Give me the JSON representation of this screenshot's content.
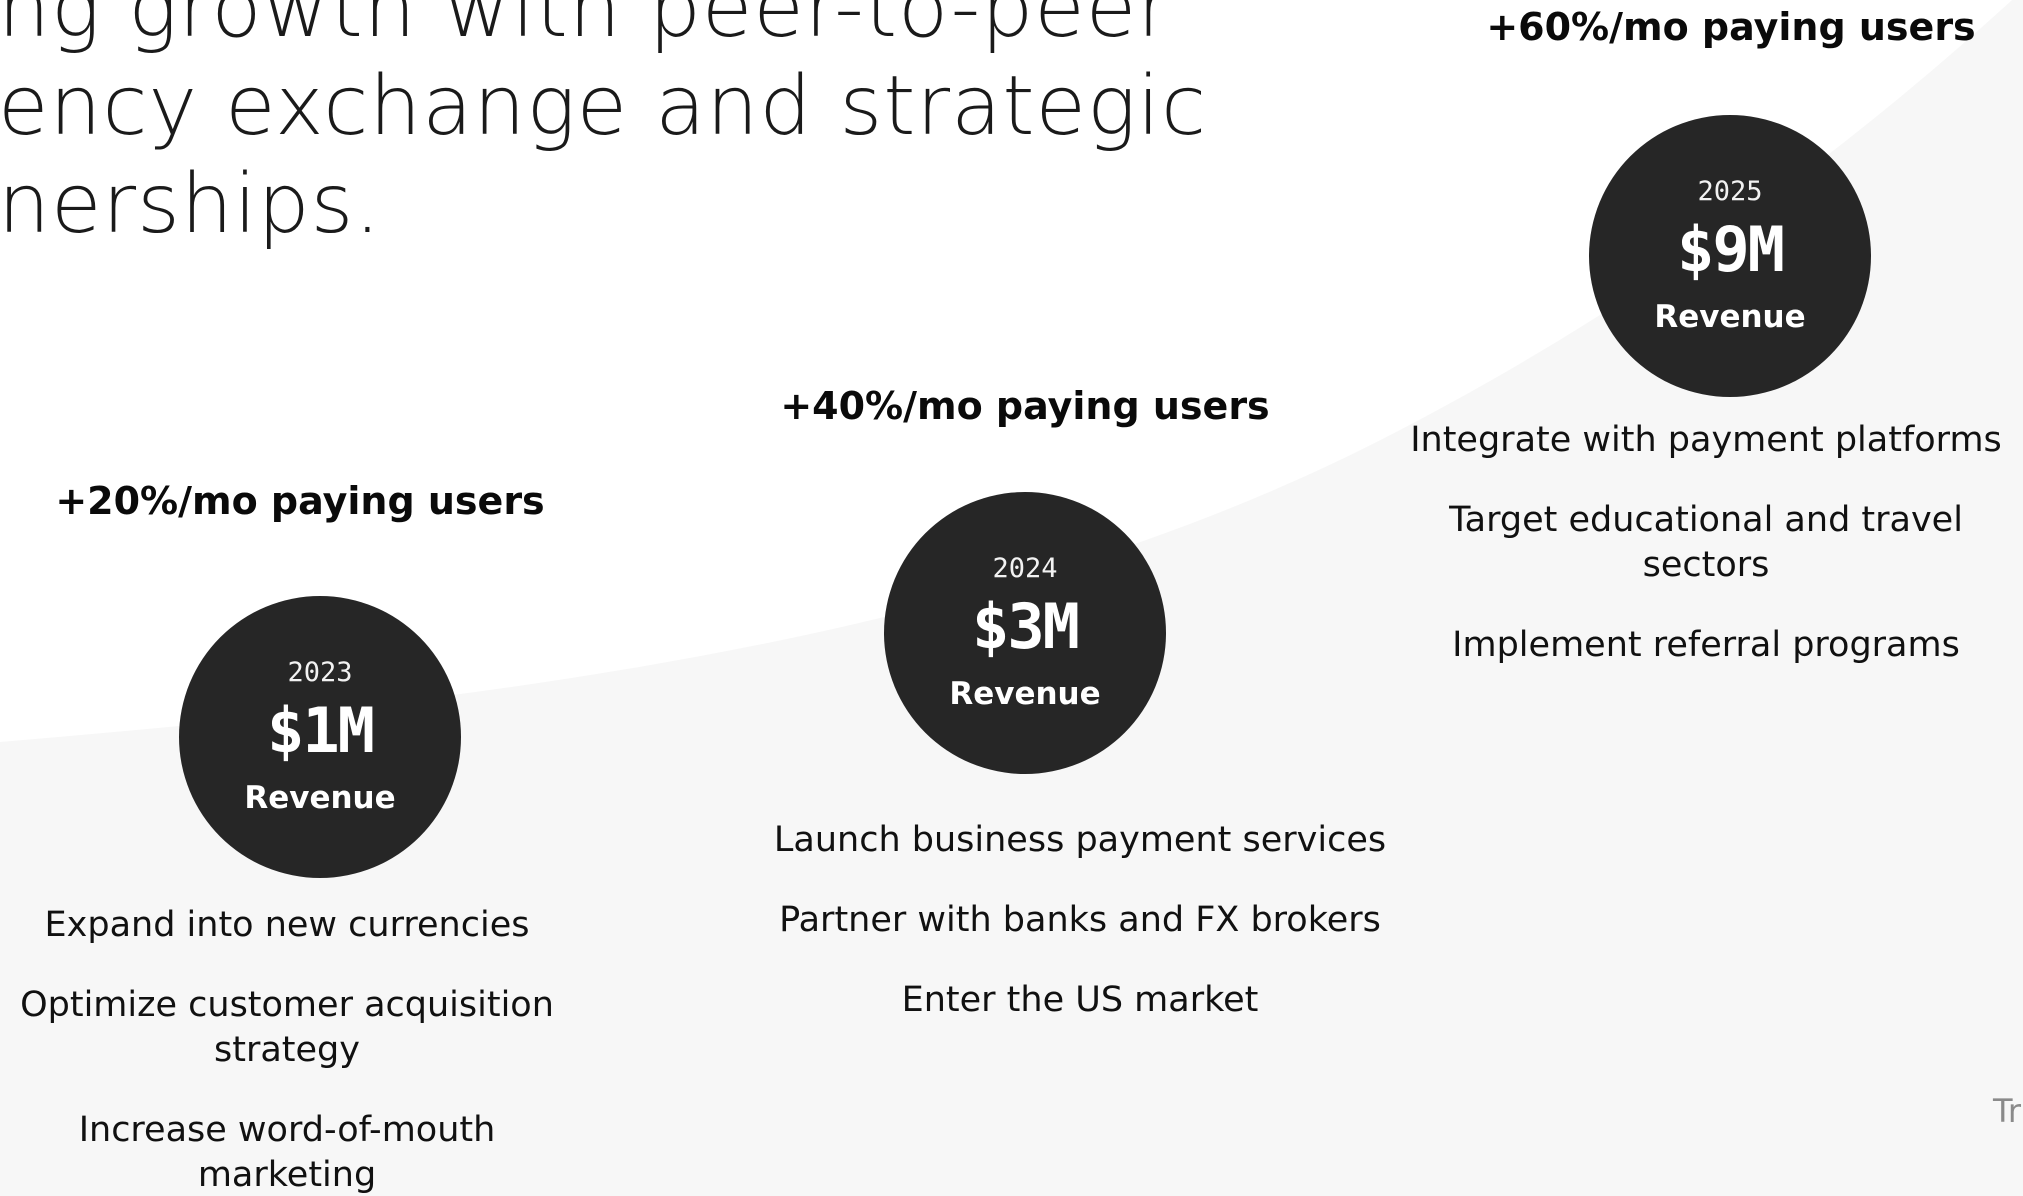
{
  "headline": {
    "lines": [
      "ng growth with peer-to-peer",
      "ency exchange and strategic",
      "nerships."
    ]
  },
  "milestones": [
    {
      "growth": "+20%/mo paying users",
      "year": "2023",
      "amount": "$1M",
      "label": "Revenue",
      "actions": [
        "Expand into new currencies",
        "Optimize customer acquisition strategy",
        "Increase word-of-mouth marketing"
      ]
    },
    {
      "growth": "+40%/mo paying users",
      "year": "2024",
      "amount": "$3M",
      "label": "Revenue",
      "actions": [
        "Launch business payment services",
        "Partner with banks and FX brokers",
        "Enter the US market"
      ]
    },
    {
      "growth": "+60%/mo paying users",
      "year": "2025",
      "amount": "$9M",
      "label": "Revenue",
      "actions": [
        "Integrate with payment platforms",
        "Target educational and travel sectors",
        "Implement referral programs"
      ]
    }
  ],
  "corner_text": "Tr",
  "colors": {
    "circle": "#262626",
    "curve_fill": "#f7f7f7",
    "text": "#111111",
    "muted_text": "#8a8a8a"
  }
}
